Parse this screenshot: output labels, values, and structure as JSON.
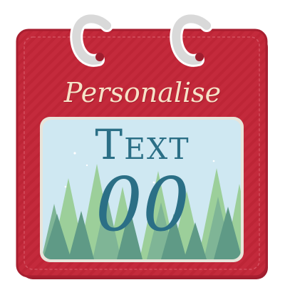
{
  "card": {
    "heading": "Personalise",
    "title_text": "Text",
    "number_text": "00"
  },
  "colors": {
    "frame": "#c42a3c",
    "frame_dark": "#9e1d2e",
    "ring": "#d9d9d9",
    "heading": "#f6e2c8",
    "scene_sky": "#cfe8f2",
    "tree_dark": "#5f9a86",
    "tree_light": "#9ccf9a",
    "text": "#2b6f86"
  },
  "icons": [
    "calendar-ring-icon",
    "calendar-ring-icon",
    "pine-tree-icon"
  ]
}
